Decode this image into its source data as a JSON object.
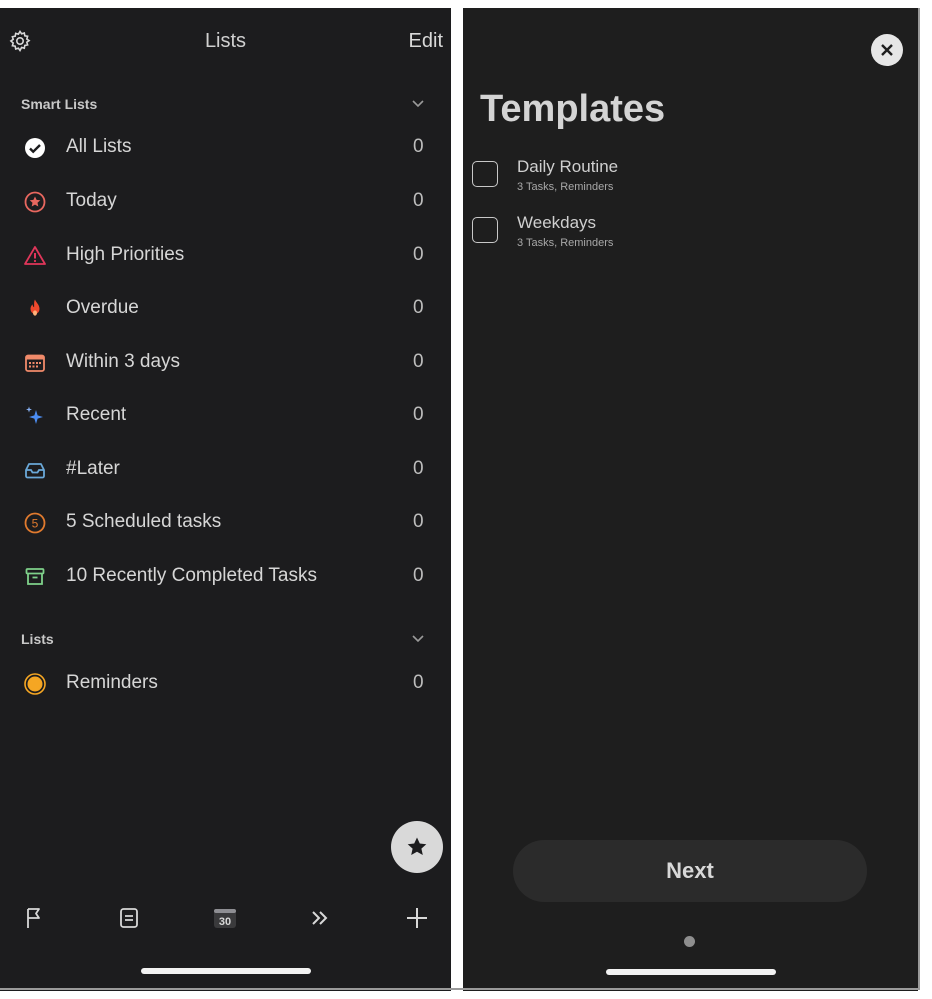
{
  "lists_screen": {
    "header": {
      "title": "Lists",
      "edit_label": "Edit"
    },
    "smart_section": {
      "label": "Smart Lists"
    },
    "smart_lists": [
      {
        "label": "All Lists",
        "count": "0",
        "icon": "check-circle-icon",
        "color": "#ffffff"
      },
      {
        "label": "Today",
        "count": "0",
        "icon": "star-circle-icon",
        "color": "#e8675f"
      },
      {
        "label": "High Priorities",
        "count": "0",
        "icon": "warning-icon",
        "color": "#e0365a"
      },
      {
        "label": "Overdue",
        "count": "0",
        "icon": "flame-icon",
        "color": "#f0492d"
      },
      {
        "label": "Within 3 days",
        "count": "0",
        "icon": "calendar-icon",
        "color": "#f08a6a"
      },
      {
        "label": "Recent",
        "count": "0",
        "icon": "sparkle-icon",
        "color": "#4c8cf0"
      },
      {
        "label": "#Later",
        "count": "0",
        "icon": "tray-icon",
        "color": "#6aa8d8"
      },
      {
        "label": "5 Scheduled tasks",
        "count": "0",
        "icon": "number-circle-icon",
        "icon_text": "5",
        "color": "#e07a2e"
      },
      {
        "label": "10 Recently Completed Tasks",
        "count": "0",
        "icon": "archive-icon",
        "color": "#7ed08a"
      }
    ],
    "lists_section": {
      "label": "Lists"
    },
    "lists": [
      {
        "label": "Reminders",
        "count": "0",
        "icon": "dot-circle-icon",
        "color": "#f5a623"
      }
    ],
    "toolbar": {
      "calendar_day": "30",
      "icons": [
        "flag-icon",
        "note-icon",
        "calendar-icon",
        "forward-icon",
        "plus-icon"
      ]
    }
  },
  "templates_screen": {
    "title": "Templates",
    "templates": [
      {
        "name": "Daily Routine",
        "detail": "3 Tasks, Reminders"
      },
      {
        "name": "Weekdays",
        "detail": "3 Tasks, Reminders"
      }
    ],
    "next_label": "Next"
  }
}
